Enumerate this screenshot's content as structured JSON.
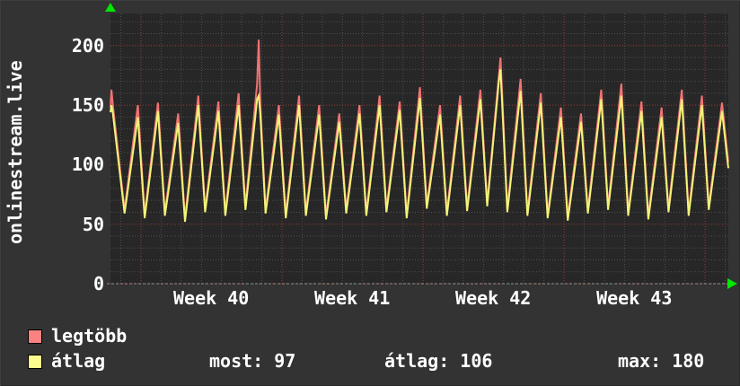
{
  "title": "onlinestream.live",
  "colors": {
    "background": "#333333",
    "canvas": "#272727",
    "grid_minor": "#4f4f4f",
    "grid_major": "#9c3c34",
    "axis_line": "#909090",
    "arrow_green": "#00e800",
    "text": "#ffffff",
    "series_max_line": "#f07373",
    "series_avg_line": "#f3f378",
    "legend_max_swatch": "#fa8281",
    "legend_avg_swatch": "#fbfb8e"
  },
  "legend": {
    "items": [
      {
        "label": "legtöbb",
        "color": "#fa8281"
      },
      {
        "label": "átlag",
        "color": "#fbfb8e"
      }
    ]
  },
  "stats_row": {
    "most": "most: 97",
    "atlag": "átlag: 106",
    "max": "max: 180"
  },
  "chart_data": {
    "type": "line",
    "title": "onlinestream.live",
    "x_domain": [
      0,
      30.67
    ],
    "y_domain": [
      0,
      227
    ],
    "yticks": [
      0,
      50,
      100,
      150,
      200
    ],
    "xticks": [
      {
        "label": "Week 40",
        "t": 5.0
      },
      {
        "label": "Week 41",
        "t": 12.0
      },
      {
        "label": "Week 42",
        "t": 19.0
      },
      {
        "label": "Week 43",
        "t": 26.0
      }
    ],
    "grid": {
      "x_minor_start": 0.516,
      "x_minor_step": 1,
      "x_major_start": 1.516,
      "x_major_step": 7,
      "y_minor_step": 10,
      "y_major_step": 50
    },
    "legend_position": "bottom-left",
    "stats": {
      "most": 97,
      "atlag": 106,
      "max": 180
    },
    "series": [
      {
        "name": "legtöbb",
        "color": "#f07373",
        "points": [
          [
            0,
            148
          ],
          [
            0.05,
            163
          ],
          [
            0.12,
            150
          ],
          [
            0.7,
            62
          ],
          [
            1.36,
            150
          ],
          [
            1.7,
            58
          ],
          [
            2.36,
            152
          ],
          [
            2.7,
            60
          ],
          [
            3.36,
            143
          ],
          [
            3.7,
            55
          ],
          [
            4.36,
            158
          ],
          [
            4.7,
            63
          ],
          [
            5.36,
            153
          ],
          [
            5.7,
            60
          ],
          [
            6.36,
            160
          ],
          [
            6.7,
            65
          ],
          [
            7.28,
            168
          ],
          [
            7.36,
            205
          ],
          [
            7.44,
            150
          ],
          [
            7.7,
            62
          ],
          [
            8.36,
            150
          ],
          [
            8.7,
            58
          ],
          [
            9.36,
            158
          ],
          [
            9.7,
            60
          ],
          [
            10.36,
            150
          ],
          [
            10.7,
            57
          ],
          [
            11.36,
            143
          ],
          [
            11.7,
            62
          ],
          [
            12.36,
            150
          ],
          [
            12.7,
            60
          ],
          [
            13.36,
            158
          ],
          [
            13.7,
            63
          ],
          [
            14.36,
            153
          ],
          [
            14.7,
            58
          ],
          [
            15.36,
            165
          ],
          [
            15.7,
            66
          ],
          [
            16.36,
            150
          ],
          [
            16.7,
            60
          ],
          [
            17.36,
            158
          ],
          [
            17.7,
            64
          ],
          [
            18.36,
            163
          ],
          [
            18.7,
            68
          ],
          [
            19.28,
            175
          ],
          [
            19.36,
            190
          ],
          [
            19.44,
            160
          ],
          [
            19.7,
            63
          ],
          [
            20.36,
            172
          ],
          [
            20.7,
            60
          ],
          [
            21.36,
            160
          ],
          [
            21.7,
            58
          ],
          [
            22.36,
            148
          ],
          [
            22.7,
            56
          ],
          [
            23.36,
            143
          ],
          [
            23.7,
            62
          ],
          [
            24.36,
            163
          ],
          [
            24.7,
            65
          ],
          [
            25.36,
            168
          ],
          [
            25.7,
            60
          ],
          [
            26.36,
            153
          ],
          [
            26.7,
            57
          ],
          [
            27.36,
            148
          ],
          [
            27.7,
            63
          ],
          [
            28.36,
            163
          ],
          [
            28.7,
            60
          ],
          [
            29.36,
            158
          ],
          [
            29.7,
            65
          ],
          [
            30.36,
            152
          ],
          [
            30.67,
            102
          ]
        ]
      },
      {
        "name": "átlag",
        "color": "#f3f378",
        "points": [
          [
            0,
            144
          ],
          [
            0.05,
            150
          ],
          [
            0.12,
            143
          ],
          [
            0.7,
            59
          ],
          [
            1.36,
            140
          ],
          [
            1.7,
            55
          ],
          [
            2.36,
            145
          ],
          [
            2.7,
            57
          ],
          [
            3.36,
            135
          ],
          [
            3.7,
            52
          ],
          [
            4.36,
            150
          ],
          [
            4.7,
            60
          ],
          [
            5.36,
            145
          ],
          [
            5.7,
            57
          ],
          [
            6.36,
            150
          ],
          [
            6.7,
            62
          ],
          [
            7.28,
            155
          ],
          [
            7.36,
            158
          ],
          [
            7.44,
            142
          ],
          [
            7.7,
            59
          ],
          [
            8.36,
            142
          ],
          [
            8.7,
            55
          ],
          [
            9.36,
            150
          ],
          [
            9.7,
            57
          ],
          [
            10.36,
            142
          ],
          [
            10.7,
            54
          ],
          [
            11.36,
            136
          ],
          [
            11.7,
            59
          ],
          [
            12.36,
            143
          ],
          [
            12.7,
            57
          ],
          [
            13.36,
            150
          ],
          [
            13.7,
            60
          ],
          [
            14.36,
            146
          ],
          [
            14.7,
            55
          ],
          [
            15.36,
            156
          ],
          [
            15.7,
            63
          ],
          [
            16.36,
            142
          ],
          [
            16.7,
            57
          ],
          [
            17.36,
            150
          ],
          [
            17.7,
            61
          ],
          [
            18.36,
            155
          ],
          [
            18.7,
            65
          ],
          [
            19.28,
            170
          ],
          [
            19.36,
            180
          ],
          [
            19.44,
            152
          ],
          [
            19.7,
            60
          ],
          [
            20.36,
            162
          ],
          [
            20.7,
            57
          ],
          [
            21.36,
            152
          ],
          [
            21.7,
            55
          ],
          [
            22.36,
            140
          ],
          [
            22.7,
            53
          ],
          [
            23.36,
            136
          ],
          [
            23.7,
            59
          ],
          [
            24.36,
            155
          ],
          [
            24.7,
            62
          ],
          [
            25.36,
            158
          ],
          [
            25.7,
            57
          ],
          [
            26.36,
            145
          ],
          [
            26.7,
            54
          ],
          [
            27.36,
            140
          ],
          [
            27.7,
            60
          ],
          [
            28.36,
            155
          ],
          [
            28.7,
            57
          ],
          [
            29.36,
            150
          ],
          [
            29.7,
            62
          ],
          [
            30.36,
            145
          ],
          [
            30.67,
            97
          ]
        ]
      }
    ]
  }
}
